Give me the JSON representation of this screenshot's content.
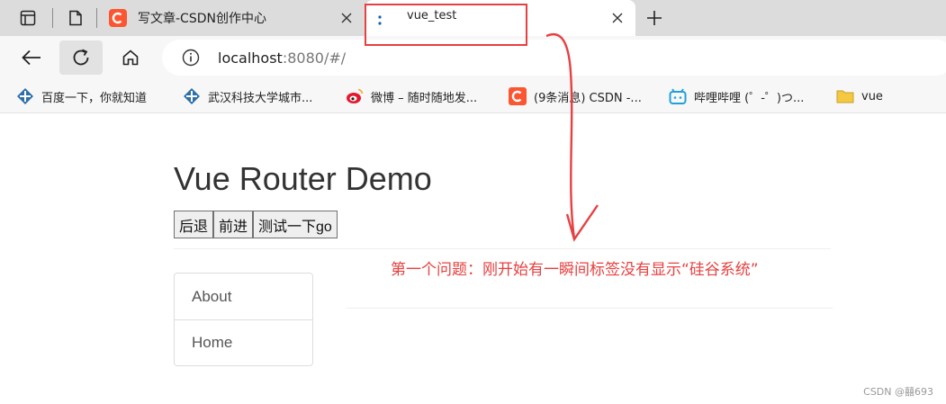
{
  "browser": {
    "tabs": [
      {
        "title": "写文章-CSDN创作中心",
        "active": false
      },
      {
        "title": "vue_test",
        "active": true
      }
    ],
    "address": {
      "host": "localhost",
      "rest": ":8080/#/"
    },
    "bookmarks": [
      {
        "label": "百度一下，你就知道",
        "icon": "baidu-icon"
      },
      {
        "label": "武汉科技大学城市...",
        "icon": "baidu-icon"
      },
      {
        "label": "微博 – 随时随地发...",
        "icon": "weibo-icon"
      },
      {
        "label": "(9条消息) CSDN -...",
        "icon": "csdn-icon"
      },
      {
        "label": "哔哩哔哩 (゜-゜)つ...",
        "icon": "bilibili-icon"
      },
      {
        "label": "vue",
        "icon": "folder-icon"
      }
    ]
  },
  "page": {
    "title": "Vue Router Demo",
    "buttons": [
      "后退",
      "前进",
      "测试一下go"
    ],
    "nav": [
      "About",
      "Home"
    ]
  },
  "annotation": {
    "text": "第一个问题：刚开始有一瞬间标签没有显示“硅谷系统”"
  },
  "watermark": "CSDN @囍693",
  "colors": {
    "annotation": "#e84040",
    "csdn": "#fc5531",
    "bilibili": "#20a0db"
  }
}
